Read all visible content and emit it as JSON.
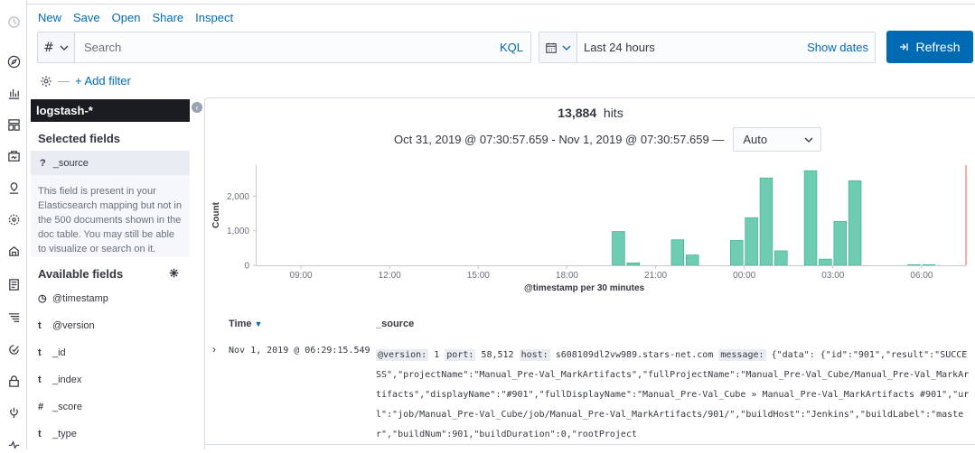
{
  "nav": {
    "icons": [
      "clock-icon",
      "compass-icon",
      "visualize-icon",
      "dashboard-icon",
      "canvas-icon",
      "maps-icon",
      "ml-icon",
      "infrastructure-icon",
      "logs-icon",
      "apm-icon",
      "uptime-icon",
      "siem-icon",
      "dev-tools-icon",
      "monitoring-icon"
    ]
  },
  "menu": {
    "new": "New",
    "save": "Save",
    "open": "Open",
    "share": "Share",
    "inspect": "Inspect"
  },
  "query": {
    "lang_symbol": "#",
    "placeholder": "Search",
    "kql": "KQL"
  },
  "time": {
    "range": "Last 24 hours",
    "show_dates": "Show dates"
  },
  "refresh_label": "Refresh",
  "filter": {
    "add": "+ Add filter"
  },
  "sidebar": {
    "index": "logstash-*",
    "selected_title": "Selected fields",
    "selected_field": {
      "type": "?",
      "name": "_source"
    },
    "info": "This field is present in your Elasticsearch mapping but not in the 500 documents shown in the doc table. You may still be able to visualize or search on it.",
    "available_title": "Available fields",
    "fields": [
      {
        "type": "◷",
        "name": "@timestamp"
      },
      {
        "type": "t",
        "name": "@version"
      },
      {
        "type": "t",
        "name": "_id"
      },
      {
        "type": "t",
        "name": "_index"
      },
      {
        "type": "#",
        "name": "_score"
      },
      {
        "type": "t",
        "name": "_type"
      }
    ]
  },
  "hits": {
    "count": "13,884",
    "label": "hits"
  },
  "range_text": "Oct 31, 2019 @ 07:30:57.659 - Nov 1, 2019 @ 07:30:57.659 —",
  "interval": "Auto",
  "chart_data": {
    "type": "bar",
    "ylabel": "Count",
    "xlabel": "@timestamp per 30 minutes",
    "ylim": [
      0,
      2900
    ],
    "yticks": [
      {
        "v": 0,
        "label": "0"
      },
      {
        "v": 1000,
        "label": "1,000"
      },
      {
        "v": 2000,
        "label": "2,000"
      }
    ],
    "xticks": [
      {
        "h": 9,
        "label": "09:00"
      },
      {
        "h": 12,
        "label": "12:00"
      },
      {
        "h": 15,
        "label": "15:00"
      },
      {
        "h": 18,
        "label": "18:00"
      },
      {
        "h": 21,
        "label": "21:00"
      },
      {
        "h": 24,
        "label": "00:00"
      },
      {
        "h": 27,
        "label": "03:00"
      },
      {
        "h": 30,
        "label": "06:00"
      }
    ],
    "xrange": [
      7.5,
      31.5
    ],
    "bar_hours": [
      19.5,
      20.0,
      21.5,
      22.0,
      23.5,
      24.0,
      24.5,
      25.0,
      26.0,
      26.5,
      27.0,
      27.5,
      29.5,
      30.0
    ],
    "values": [
      980,
      70,
      740,
      300,
      720,
      1380,
      2530,
      420,
      2740,
      180,
      1270,
      2450,
      20,
      20
    ],
    "bar_color": "#6dccb1"
  },
  "table": {
    "col_time": "Time",
    "col_source": "_source"
  },
  "doc": {
    "time": "Nov 1, 2019 @ 06:29:15.549",
    "k_version": "@version:",
    "v_version": "1",
    "k_port": "port:",
    "v_port": "58,512",
    "k_host": "host:",
    "v_host": "s608109dl2vw989.stars-net.com",
    "k_message": "message:",
    "v_message": "{\"data\": {\"id\":\"901\",\"result\":\"SUCCESS\",\"projectName\":\"Manual_Pre-Val_MarkArtifacts\",\"fullProjectName\":\"Manual_Pre-Val_Cube/Manual_Pre-Val_MarkArtifacts\",\"displayName\":\"#901\",\"fullDisplayName\":\"Manual_Pre-Val_Cube » Manual_Pre-Val_MarkArtifacts #901\",\"url\":\"job/Manual_Pre-Val_Cube/job/Manual_Pre-Val_MarkArtifacts/901/\",\"buildHost\":\"Jenkins\",\"buildLabel\":\"master\",\"buildNum\":901,\"buildDuration\":0,\"rootProject"
  }
}
